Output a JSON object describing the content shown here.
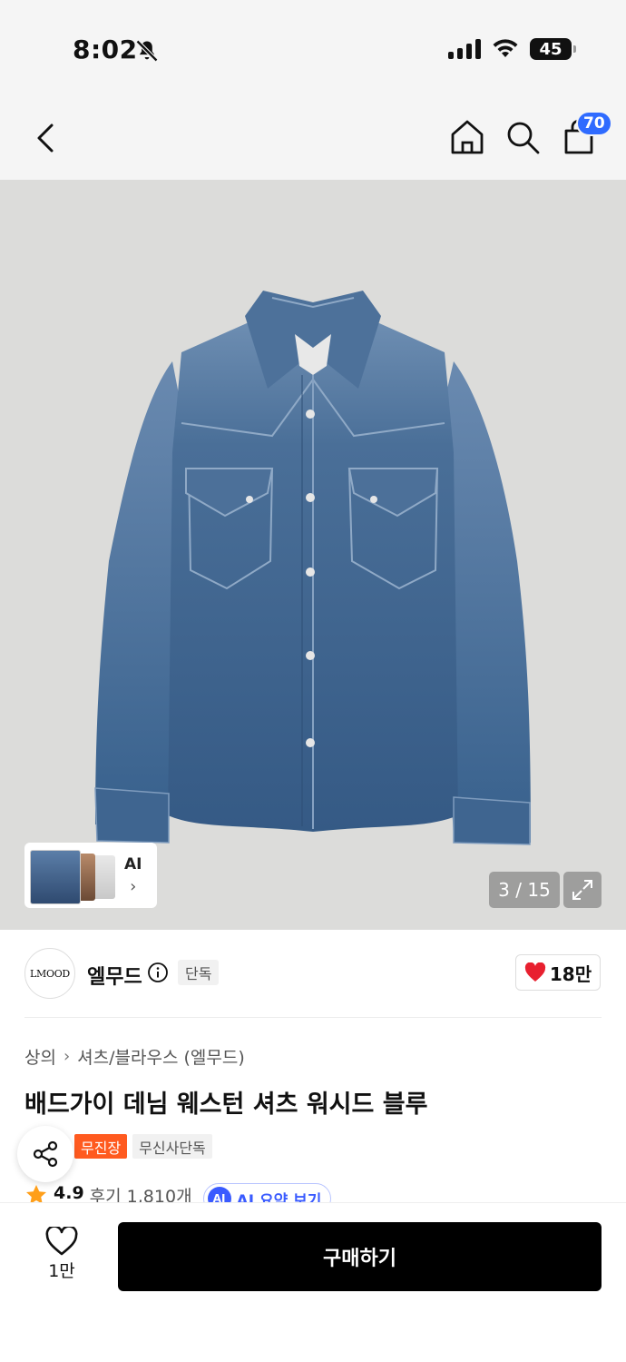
{
  "status_bar": {
    "time": "8:02",
    "battery": "45"
  },
  "header": {
    "cart_count": "70"
  },
  "gallery": {
    "ai_label": "AI",
    "ai_chevron": "›",
    "counter": "3 / 15"
  },
  "brand": {
    "logo_text": "LMOOD",
    "name": "엘무드",
    "exclusive_tag": "단독",
    "like_count": "18만"
  },
  "product": {
    "breadcrumb": {
      "category": "상의",
      "separator": "›",
      "subcategory": "셔츠/블라우스 (엘무드)"
    },
    "title": "배드가이 데님 웨스턴 셔츠 워시드 블루",
    "tags": [
      "무진장",
      "무신사단독"
    ],
    "rating": "4.9",
    "review_label": "후기 1,810개",
    "ai_summary": {
      "badge": "AI",
      "label": "AI 요약 보기"
    }
  },
  "bottom_bar": {
    "wish_count": "1만",
    "buy_label": "구매하기"
  },
  "colors": {
    "accent_blue": "#2f6bff",
    "tag_orange": "#ff5a1f",
    "heart_red": "#e8202f",
    "star": "#ff9f1a",
    "denim": "#3e6590"
  },
  "icons": {
    "back": "chevron-left-icon",
    "home": "home-icon",
    "search": "search-icon",
    "cart": "shopping-bag-icon",
    "expand": "expand-icon",
    "info": "info-icon",
    "like": "heart-filled-icon",
    "share": "share-icon",
    "wish": "heart-outline-icon",
    "star": "star-icon"
  }
}
